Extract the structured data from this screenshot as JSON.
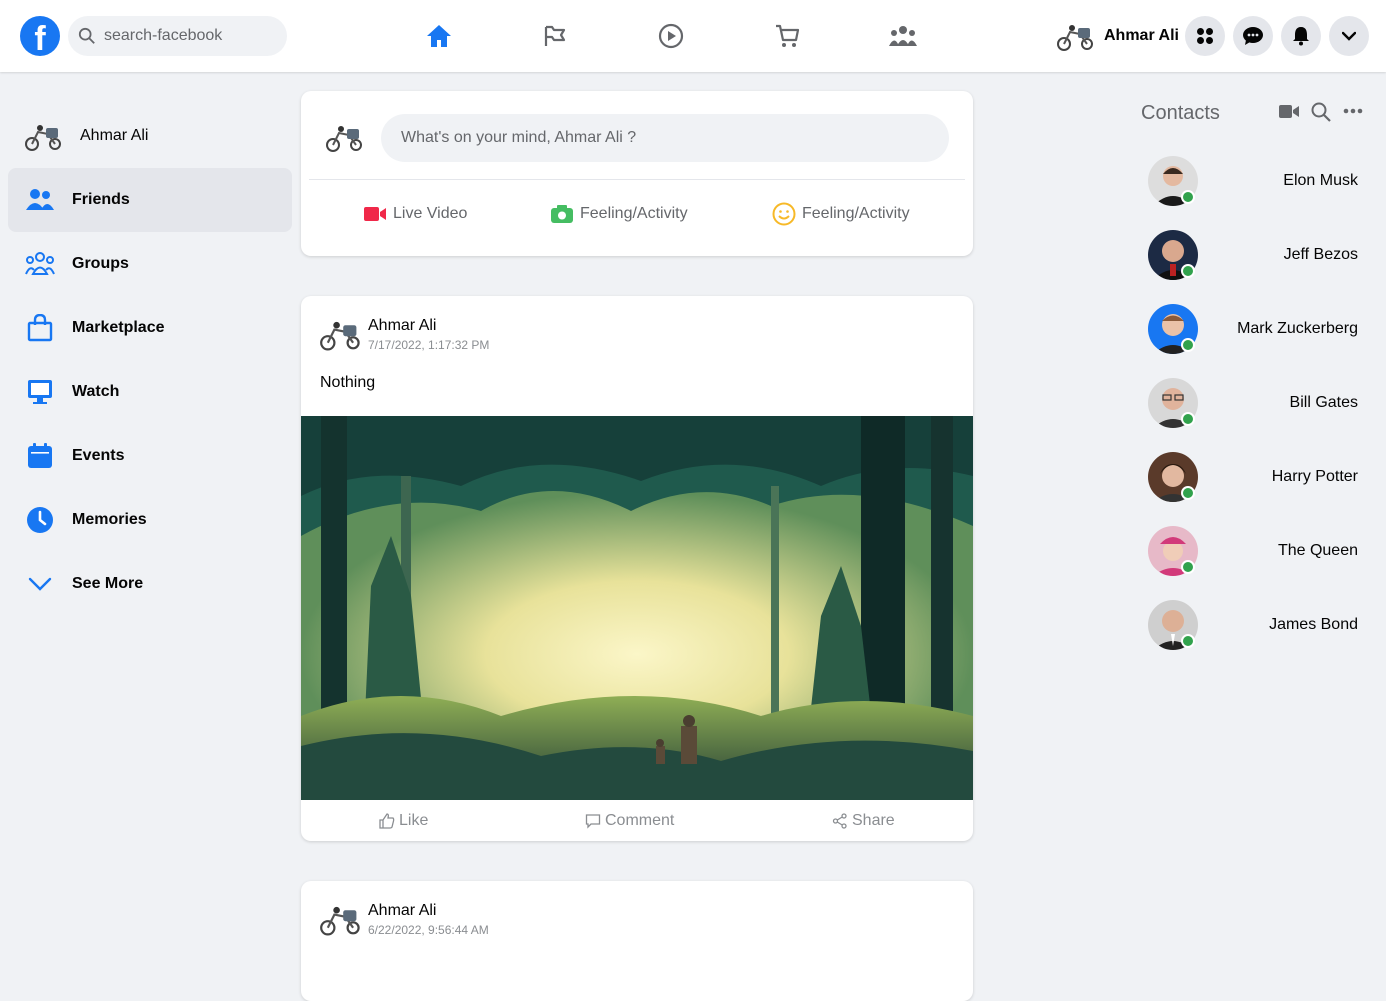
{
  "header": {
    "logo": "f",
    "search_placeholder": "search-facebook",
    "nav_icons": [
      "home-icon",
      "flag-icon",
      "video-icon",
      "cart-icon",
      "group-icon"
    ],
    "user_name": "Ahmar Ali",
    "accent": "#1877f2"
  },
  "sidebar": {
    "profile_name": "Ahmar Ali",
    "items": [
      {
        "label": "Friends",
        "icon": "friends-icon",
        "active": true
      },
      {
        "label": "Groups",
        "icon": "groups-icon"
      },
      {
        "label": "Marketplace",
        "icon": "marketplace-icon"
      },
      {
        "label": "Watch",
        "icon": "watch-icon"
      },
      {
        "label": "Events",
        "icon": "events-icon"
      },
      {
        "label": "Memories",
        "icon": "memories-icon"
      },
      {
        "label": "See More",
        "icon": "chevron-down-icon"
      }
    ]
  },
  "composer": {
    "placeholder": "What's on your mind, Ahmar Ali ?",
    "actions": [
      {
        "label": "Live Video",
        "icon": "live-video-icon"
      },
      {
        "label": "Feeling/Activity",
        "icon": "photo-icon"
      },
      {
        "label": "Feeling/Activity",
        "icon": "smile-icon"
      }
    ]
  },
  "posts": [
    {
      "author": "Ahmar Ali",
      "time": "7/17/2022, 1:17:32 PM",
      "text": "Nothing",
      "like": "Like",
      "comment": "Comment",
      "share": "Share"
    },
    {
      "author": "Ahmar Ali",
      "time": "6/22/2022, 9:56:44 AM"
    }
  ],
  "contacts": {
    "title": "Contacts",
    "people": [
      "Elon Musk",
      "Jeff Bezos",
      "Mark Zuckerberg",
      "Bill Gates",
      "Harry Potter",
      "The Queen",
      "James Bond"
    ]
  }
}
